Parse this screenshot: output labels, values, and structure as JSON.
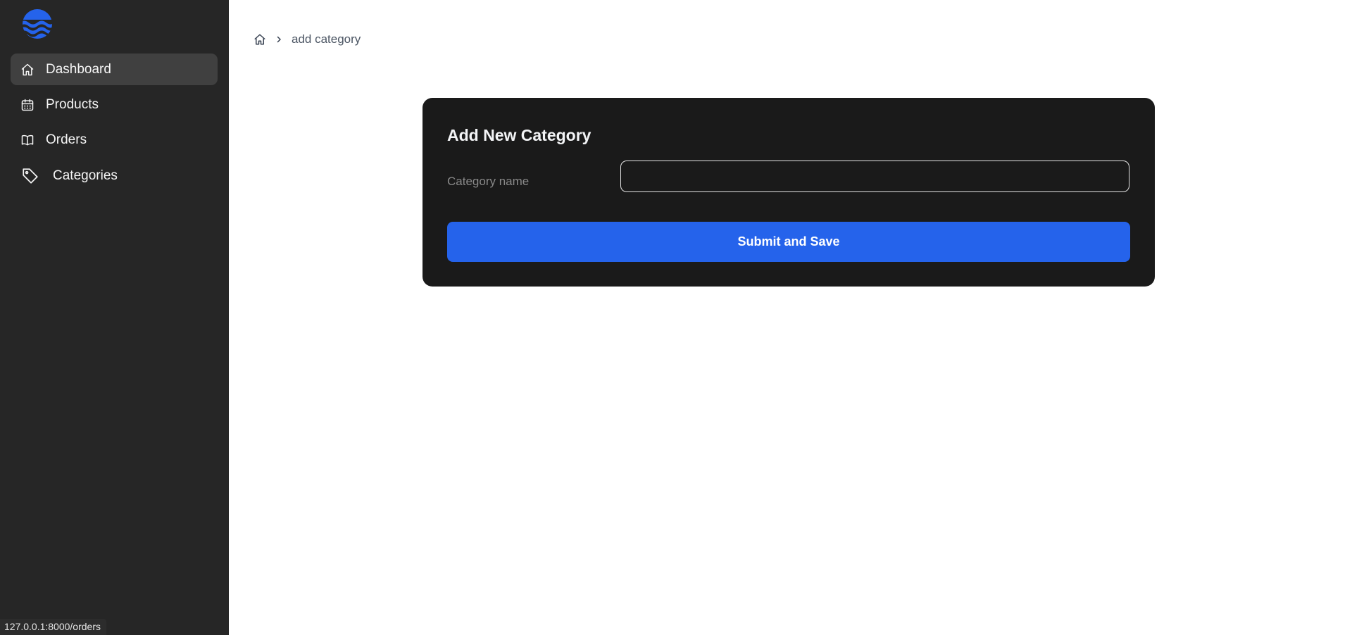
{
  "brand": {
    "logo_icon": "waves-logo-icon",
    "accent": "#2563eb"
  },
  "sidebar": {
    "items": [
      {
        "label": "Dashboard",
        "icon": "home-icon",
        "active": true
      },
      {
        "label": "Products",
        "icon": "calendar-icon",
        "active": false
      },
      {
        "label": "Orders",
        "icon": "book-open-icon",
        "active": false
      },
      {
        "label": "Categories",
        "icon": "tag-icon",
        "active": false
      }
    ]
  },
  "breadcrumb": {
    "home_icon": "home-icon",
    "separator_icon": "chevron-right-icon",
    "current": "add category"
  },
  "form": {
    "title": "Add New Category",
    "category_label": "Category name",
    "category_value": "",
    "category_placeholder": "",
    "submit_label": "Submit and Save"
  },
  "status_bar": {
    "url": "127.0.0.1:8000/orders"
  }
}
